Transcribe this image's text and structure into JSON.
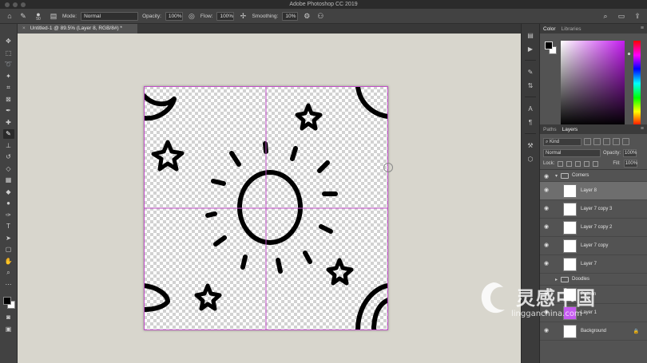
{
  "app": {
    "window_title": "Adobe Photoshop CC 2019"
  },
  "options_bar": {
    "brush_size": "50",
    "mode_label": "Mode:",
    "mode_value": "Normal",
    "opacity_label": "Opacity:",
    "opacity_value": "100%",
    "flow_label": "Flow:",
    "flow_value": "100%",
    "smoothing_label": "Smoothing:",
    "smoothing_value": "10%"
  },
  "document_tab": {
    "label": "Untitled-1 @ 89.5% (Layer 8, RGB/8#) *",
    "close": "×"
  },
  "tools": [
    "move-icon",
    "marquee-icon",
    "lasso-icon",
    "magic-wand-icon",
    "crop-icon",
    "frame-icon",
    "eyedropper-icon",
    "healing-icon",
    "brush-icon",
    "stamp-icon",
    "history-brush-icon",
    "eraser-icon",
    "gradient-icon",
    "blur-icon",
    "dodge-icon",
    "pen-icon",
    "type-icon",
    "path-select-icon",
    "shape-icon",
    "hand-icon",
    "zoom-icon",
    "more-icon"
  ],
  "color_panel": {
    "tabs": [
      "Color",
      "Libraries"
    ],
    "hue_color": "#c41cf0"
  },
  "layers_panel": {
    "tabs": [
      "Paths",
      "Layers"
    ],
    "filter_kind": "Kind",
    "blend_mode": "Normal",
    "opacity_label": "Opacity:",
    "opacity_value": "100%",
    "lock_label": "Lock:",
    "fill_label": "Fill:",
    "fill_value": "100%",
    "layers": [
      {
        "type": "group",
        "name": "Corners",
        "expanded": true
      },
      {
        "type": "layer",
        "name": "Layer 8",
        "selected": true
      },
      {
        "type": "layer",
        "name": "Layer 7 copy 3"
      },
      {
        "type": "layer",
        "name": "Layer 7 copy 2"
      },
      {
        "type": "layer",
        "name": "Layer 7 copy"
      },
      {
        "type": "layer",
        "name": "Layer 7"
      },
      {
        "type": "group",
        "name": "Doodles",
        "expanded": false
      },
      {
        "type": "layer",
        "name": "Pattern"
      },
      {
        "type": "layer",
        "name": "Layer 1",
        "thumb_color": "#c55af0"
      },
      {
        "type": "layer",
        "name": "Background",
        "locked": true
      }
    ]
  },
  "watermark": {
    "text": "灵感中国",
    "url": "lingganchina.com"
  },
  "colors": {
    "guide": "#c14fc8",
    "accent_purple": "#c55af0"
  }
}
